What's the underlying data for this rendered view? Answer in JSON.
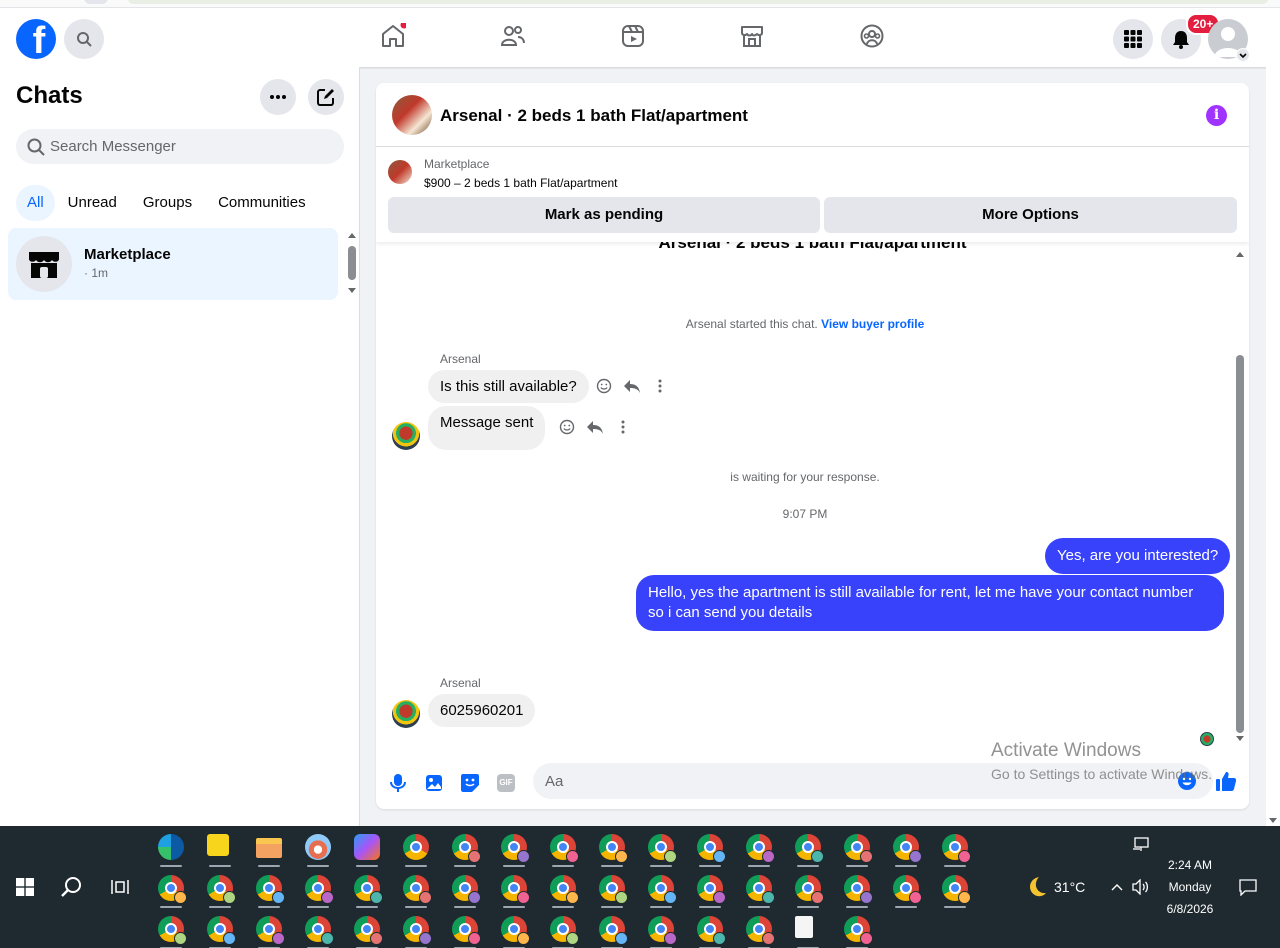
{
  "topnav": {
    "logo": "f",
    "notification_badge": "20+"
  },
  "sidebar": {
    "title": "Chats",
    "search_placeholder": "Search Messenger",
    "tabs": [
      {
        "label": "All",
        "active": true
      },
      {
        "label": "Unread",
        "active": false
      },
      {
        "label": "Groups",
        "active": false
      },
      {
        "label": "Communities",
        "active": false
      }
    ],
    "chats": [
      {
        "name": "Marketplace",
        "time": "· 1m"
      }
    ]
  },
  "conversation": {
    "title": "Arsenal · 2 beds 1 bath Flat/apartment",
    "marketplace_label": "Marketplace",
    "listing": "$900 – 2 beds 1 bath Flat/apartment",
    "mark_pending_label": "Mark as pending",
    "more_options_label": "More Options",
    "cut_title": "Arsenal · 2 beds 1 bath Flat/apartment",
    "started_text": "Arsenal started this chat.",
    "view_profile_link": "View buyer profile",
    "messages": [
      {
        "sender": "Arsenal",
        "text": "Is this still available?"
      },
      {
        "text": "Message sent"
      },
      {
        "system": "is waiting for your response."
      },
      {
        "timestamp": "9:07 PM"
      },
      {
        "outgoing": "Yes, are you interested?"
      },
      {
        "outgoing": "Hello, yes the apartment is still available for rent, let me have your contact number so i can send you details"
      },
      {
        "sender": "Arsenal",
        "text": "6025960201"
      }
    ],
    "composer_placeholder": "Aa",
    "gif_label": "GIF"
  },
  "watermark": {
    "line1": "Activate Windows",
    "line2": "Go to Settings to activate Windows."
  },
  "taskbar": {
    "temperature": "31°C",
    "time": "2:24 AM",
    "day": "Monday",
    "date": "6/8/2026"
  },
  "colors": {
    "facebook_blue": "#0866ff",
    "outgoing_bubble": "#3742fa",
    "info_purple": "#a033ff",
    "badge_red": "#e41e3f",
    "taskbar_bg": "#1f2a30"
  }
}
